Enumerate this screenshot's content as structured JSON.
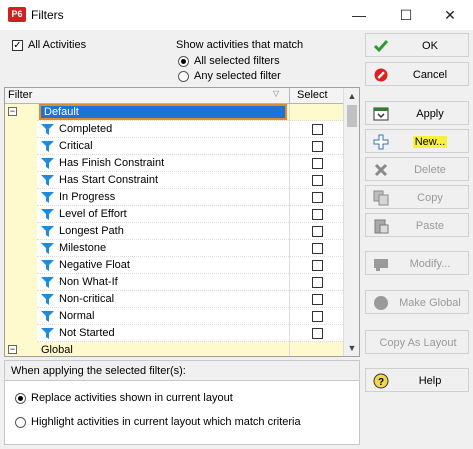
{
  "window": {
    "app_icon": "P6",
    "title": "Filters",
    "minimize_glyph": "—",
    "maximize_glyph": "☐",
    "close_glyph": "✕"
  },
  "options": {
    "all_activities_label": "All Activities",
    "all_activities_checked": true,
    "match_heading": "Show activities that match",
    "match_all_label": "All selected filters",
    "match_any_label": "Any selected filter",
    "match_selected": "all"
  },
  "grid": {
    "col_filter": "Filter",
    "col_select": "Select",
    "default_group": "Default",
    "global_group": "Global",
    "expander_minus": "−",
    "filters": [
      "Completed",
      "Critical",
      "Has Finish Constraint",
      "Has Start Constraint",
      "In Progress",
      "Level of Effort",
      "Longest Path",
      "Milestone",
      "Negative Float",
      "Non What-If",
      "Non-critical",
      "Normal",
      "Not Started"
    ]
  },
  "apply_section": {
    "heading": "When applying the selected filter(s):",
    "replace_label": "Replace activities shown in current layout",
    "highlight_label": "Highlight activities in current layout which match criteria",
    "selected": "replace"
  },
  "buttons": {
    "ok": "OK",
    "cancel": "Cancel",
    "apply": "Apply",
    "new": "New...",
    "delete": "Delete",
    "copy": "Copy",
    "paste": "Paste",
    "modify": "Modify...",
    "make_global": "Make Global",
    "copy_as_layout": "Copy As Layout",
    "help": "Help"
  },
  "colors": {
    "accent_selection": "#1e73d8",
    "focus_outline": "#e0892d",
    "tree_background": "#fffacd",
    "funnel_icon": "#1c8be0",
    "new_highlight": "#f8f23c",
    "app_icon": "#d21f1f"
  }
}
